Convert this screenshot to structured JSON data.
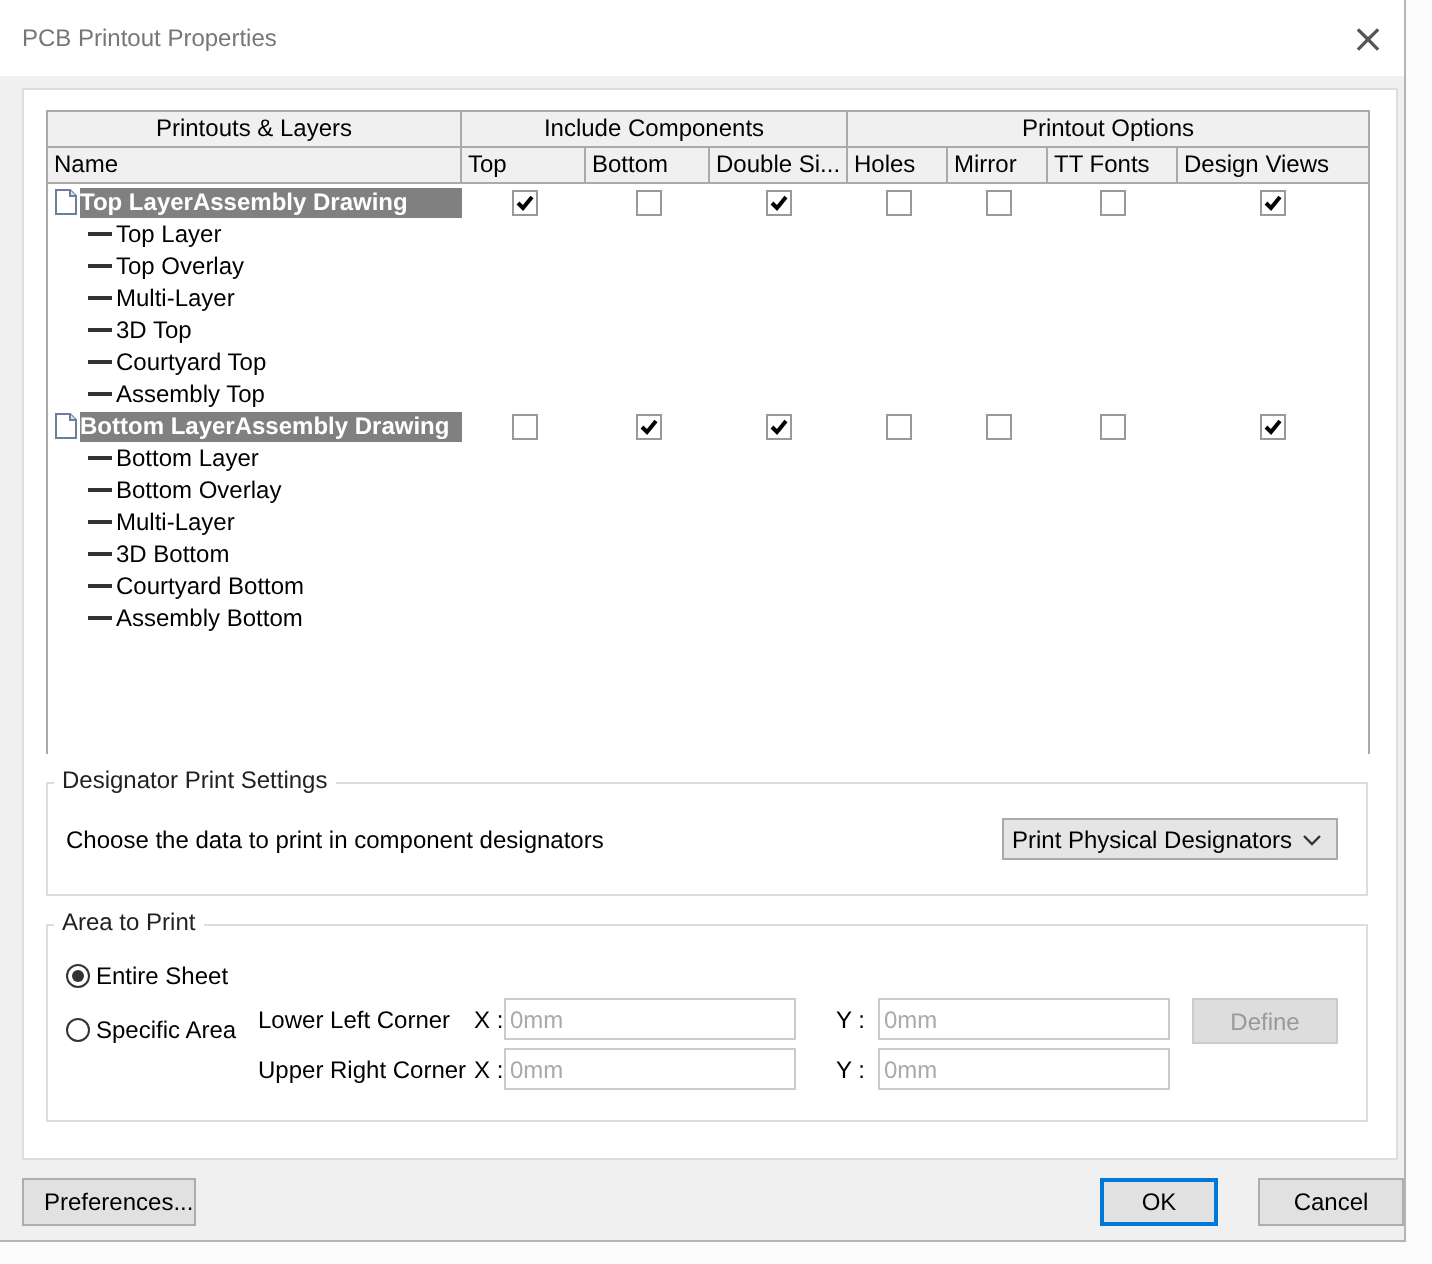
{
  "window": {
    "title": "PCB Printout Properties",
    "close": "×"
  },
  "table": {
    "column_groups": [
      {
        "label": "Printouts & Layers"
      },
      {
        "label": "Include Components"
      },
      {
        "label": "Printout Options"
      }
    ],
    "columns": [
      "Name",
      "Top",
      "Bottom",
      "Double Si...",
      "Holes",
      "Mirror",
      "TT Fonts",
      "Design Views"
    ],
    "rows": [
      {
        "name": "Top LayerAssembly Drawing",
        "checks": [
          true,
          false,
          true,
          false,
          false,
          false,
          true
        ],
        "children": [
          {
            "name": "Top Layer"
          },
          {
            "name": "Top Overlay"
          },
          {
            "name": "Multi-Layer"
          },
          {
            "name": "3D Top"
          },
          {
            "name": "Courtyard Top"
          },
          {
            "name": "Assembly Top"
          }
        ]
      },
      {
        "name": "Bottom LayerAssembly Drawing",
        "checks": [
          false,
          true,
          true,
          false,
          false,
          false,
          true
        ],
        "children": [
          {
            "name": "Bottom Layer"
          },
          {
            "name": "Bottom Overlay"
          },
          {
            "name": "Multi-Layer"
          },
          {
            "name": "3D Bottom"
          },
          {
            "name": "Courtyard Bottom"
          },
          {
            "name": "Assembly Bottom"
          }
        ]
      }
    ]
  },
  "designator": {
    "title": "Designator Print Settings",
    "label": "Choose the data to print in component designators",
    "value": "Print Physical Designators"
  },
  "area": {
    "title": "Area to Print",
    "options": [
      {
        "label": "Entire Sheet",
        "selected": true
      },
      {
        "label": "Specific Area",
        "selected": false
      }
    ],
    "corners": [
      {
        "label": "Lower Left Corner",
        "x_label": "X :",
        "x_value": "0mm",
        "y_label": "Y :",
        "y_value": "0mm"
      },
      {
        "label": "Upper Right Corner",
        "x_label": "X :",
        "x_value": "0mm",
        "y_label": "Y :",
        "y_value": "0mm"
      }
    ],
    "define": {
      "label": "Define",
      "disabled": true
    }
  },
  "buttons": [
    {
      "label": "Preferences...",
      "kind": "left",
      "default": false
    },
    {
      "label": "OK",
      "kind": "right",
      "default": true
    },
    {
      "label": "Cancel",
      "kind": "right",
      "default": false
    }
  ]
}
